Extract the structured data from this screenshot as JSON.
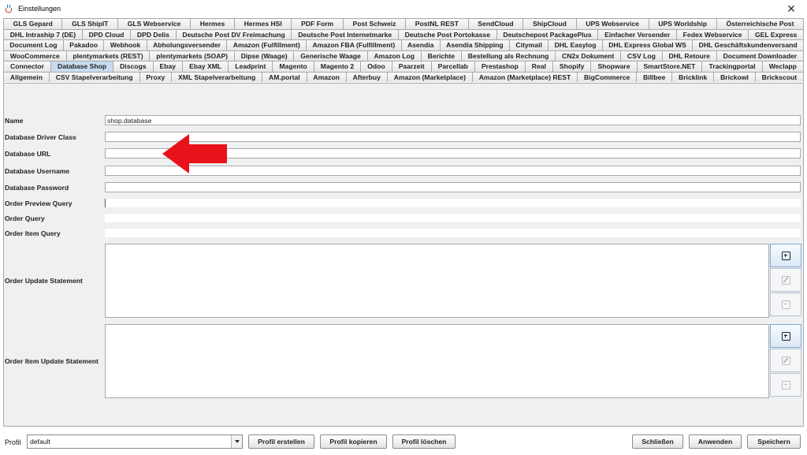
{
  "window": {
    "title": "Einstellungen",
    "close_glyph": "✕"
  },
  "tabs": {
    "rows": [
      [
        "GLS Gepard",
        "GLS ShipIT",
        "GLS Webservice",
        "Hermes",
        "Hermes HSI",
        "PDF Form",
        "Post Schweiz",
        "PostNL REST",
        "SendCloud",
        "ShipCloud",
        "UPS Webservice",
        "UPS Worldship",
        "Österreichische Post"
      ],
      [
        "DHL Intraship 7 (DE)",
        "DPD Cloud",
        "DPD Delis",
        "Deutsche Post DV Freimachung",
        "Deutsche Post Internetmarke",
        "Deutsche Post Portokasse",
        "Deutschepost PackagePlus",
        "Einfacher Versender",
        "Fedex Webservice",
        "GEL Express"
      ],
      [
        "Document Log",
        "Pakadoo",
        "Webhook",
        "Abholungsversender",
        "Amazon (Fulfillment)",
        "Amazon FBA (Fulfillment)",
        "Asendia",
        "Asendia Shipping",
        "Citymail",
        "DHL Easylog",
        "DHL Express Global WS",
        "DHL Geschäftskundenversand"
      ],
      [
        "WooCommerce",
        "plentymarkets (REST)",
        "plentymarkets (SOAP)",
        "Dipse (Waage)",
        "Generische Waage",
        "Amazon Log",
        "Berichte",
        "Bestellung als Rechnung",
        "CN2x Dokument",
        "CSV Log",
        "DHL Retoure",
        "Document Downloader"
      ],
      [
        "Connector",
        "Database Shop",
        "Discogs",
        "Ebay",
        "Ebay XML",
        "Leadprint",
        "Magento",
        "Magento 2",
        "Odoo",
        "Paarzeit",
        "Parcellab",
        "Prestashop",
        "Real",
        "Shopify",
        "Shopware",
        "SmartStore.NET",
        "Trackingportal",
        "Weclapp"
      ],
      [
        "Allgemein",
        "CSV Stapelverarbeitung",
        "Proxy",
        "XML Stapelverarbeitung",
        "AM.portal",
        "Amazon",
        "Afterbuy",
        "Amazon (Marketplace)",
        "Amazon (Marketplace) REST",
        "BigCommerce",
        "Billbee",
        "Bricklink",
        "Brickowl",
        "Brickscout"
      ]
    ],
    "active": "Database Shop"
  },
  "form": {
    "name_label": "Name",
    "name_value": "shop.database",
    "driver_label": "Database Driver Class",
    "driver_value": "",
    "url_label": "Database URL",
    "url_value": "",
    "username_label": "Database Username",
    "username_value": "",
    "password_label": "Database Password",
    "password_value": "",
    "preview_query_label": "Order Preview Query",
    "order_query_label": "Order Query",
    "item_query_label": "Order Item Query",
    "update_statement_label": "Order Update Statement",
    "item_update_statement_label": "Order Item Update Statement"
  },
  "icons": {
    "add": "plus-square-icon",
    "edit": "edit-icon",
    "remove": "minus-square-icon",
    "annotation": "red-arrow-left"
  },
  "colors": {
    "active_tab": "#c8dcf0",
    "arrow": "#e8121a",
    "panel_bg": "#eef0f2"
  },
  "bottom": {
    "profil_label": "Profil",
    "profil_value": "default",
    "create_label": "Profil erstellen",
    "copy_label": "Profil kopieren",
    "delete_label": "Profil löschen",
    "close_label": "Schließen",
    "apply_label": "Anwenden",
    "save_label": "Speichern"
  }
}
